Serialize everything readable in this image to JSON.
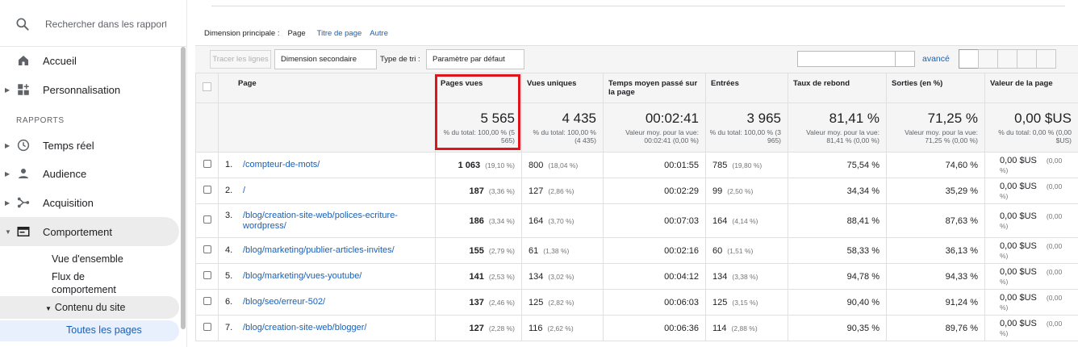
{
  "sidebar": {
    "search_placeholder": "Rechercher dans les rapport",
    "home": "Accueil",
    "customization": "Personnalisation",
    "section_reports": "RAPPORTS",
    "realtime": "Temps réel",
    "audience": "Audience",
    "acquisition": "Acquisition",
    "behavior": "Comportement",
    "overview": "Vue d'ensemble",
    "behavior_flow": "Flux de comportement",
    "site_content": "Contenu du site",
    "all_pages": "Toutes les pages"
  },
  "dimension_bar": {
    "label": "Dimension principale :",
    "current": "Page",
    "link1": "Titre de page",
    "link2": "Autre"
  },
  "toolbar": {
    "plot_rows": "Tracer les lignes",
    "secondary_dimension": "Dimension secondaire",
    "sort_type_label": "Type de tri :",
    "sort_default": "Paramètre par défaut",
    "advanced": "avancé"
  },
  "table": {
    "headers": {
      "page": "Page",
      "pageviews": "Pages vues",
      "unique": "Vues uniques",
      "avg_time": "Temps moyen passé sur la page",
      "entrances": "Entrées",
      "bounce": "Taux de rebond",
      "exits": "Sorties (en %)",
      "value": "Valeur de la page"
    },
    "totals": {
      "pageviews": "5 565",
      "pageviews_sub": "% du total: 100,00 % (5 565)",
      "unique": "4 435",
      "unique_sub": "% du total: 100,00 % (4 435)",
      "avg_time": "00:02:41",
      "avg_time_sub": "Valeur moy. pour la vue: 00:02:41 (0,00 %)",
      "entrances": "3 965",
      "entrances_sub": "% du total: 100,00 % (3 965)",
      "bounce": "81,41 %",
      "bounce_sub": "Valeur moy. pour la vue: 81,41 % (0,00 %)",
      "exits": "71,25 %",
      "exits_sub": "Valeur moy. pour la vue: 71,25 % (0,00 %)",
      "value": "0,00 $US",
      "value_sub": "% du total: 0,00 % (0,00 $US)"
    },
    "rows": [
      {
        "idx": "1.",
        "page": "/compteur-de-mots/",
        "pv": "1 063",
        "pv_pct": "(19,10 %)",
        "uv": "800",
        "uv_pct": "(18,04 %)",
        "time": "00:01:55",
        "ent": "785",
        "ent_pct": "(19,80 %)",
        "bounce": "75,54 %",
        "exits": "74,60 %",
        "val": "0,00 $US",
        "val_pct": "(0,00 %)"
      },
      {
        "idx": "2.",
        "page": "/",
        "pv": "187",
        "pv_pct": "(3,36 %)",
        "uv": "127",
        "uv_pct": "(2,86 %)",
        "time": "00:02:29",
        "ent": "99",
        "ent_pct": "(2,50 %)",
        "bounce": "34,34 %",
        "exits": "35,29 %",
        "val": "0,00 $US",
        "val_pct": "(0,00 %)"
      },
      {
        "idx": "3.",
        "page": "/blog/creation-site-web/polices-ecriture-wordpress/",
        "pv": "186",
        "pv_pct": "(3,34 %)",
        "uv": "164",
        "uv_pct": "(3,70 %)",
        "time": "00:07:03",
        "ent": "164",
        "ent_pct": "(4,14 %)",
        "bounce": "88,41 %",
        "exits": "87,63 %",
        "val": "0,00 $US",
        "val_pct": "(0,00 %)"
      },
      {
        "idx": "4.",
        "page": "/blog/marketing/publier-articles-invites/",
        "pv": "155",
        "pv_pct": "(2,79 %)",
        "uv": "61",
        "uv_pct": "(1,38 %)",
        "time": "00:02:16",
        "ent": "60",
        "ent_pct": "(1,51 %)",
        "bounce": "58,33 %",
        "exits": "36,13 %",
        "val": "0,00 $US",
        "val_pct": "(0,00 %)"
      },
      {
        "idx": "5.",
        "page": "/blog/marketing/vues-youtube/",
        "pv": "141",
        "pv_pct": "(2,53 %)",
        "uv": "134",
        "uv_pct": "(3,02 %)",
        "time": "00:04:12",
        "ent": "134",
        "ent_pct": "(3,38 %)",
        "bounce": "94,78 %",
        "exits": "94,33 %",
        "val": "0,00 $US",
        "val_pct": "(0,00 %)"
      },
      {
        "idx": "6.",
        "page": "/blog/seo/erreur-502/",
        "pv": "137",
        "pv_pct": "(2,46 %)",
        "uv": "125",
        "uv_pct": "(2,82 %)",
        "time": "00:06:03",
        "ent": "125",
        "ent_pct": "(3,15 %)",
        "bounce": "90,40 %",
        "exits": "91,24 %",
        "val": "0,00 $US",
        "val_pct": "(0,00 %)"
      },
      {
        "idx": "7.",
        "page": "/blog/creation-site-web/blogger/",
        "pv": "127",
        "pv_pct": "(2,28 %)",
        "uv": "116",
        "uv_pct": "(2,62 %)",
        "time": "00:06:36",
        "ent": "114",
        "ent_pct": "(2,88 %)",
        "bounce": "90,35 %",
        "exits": "89,76 %",
        "val": "0,00 $US",
        "val_pct": "(0,00 %)"
      }
    ]
  },
  "colors": {
    "link": "#1a5fb4",
    "highlight": "#e0141c",
    "header_bg": "#f5f5f5"
  }
}
